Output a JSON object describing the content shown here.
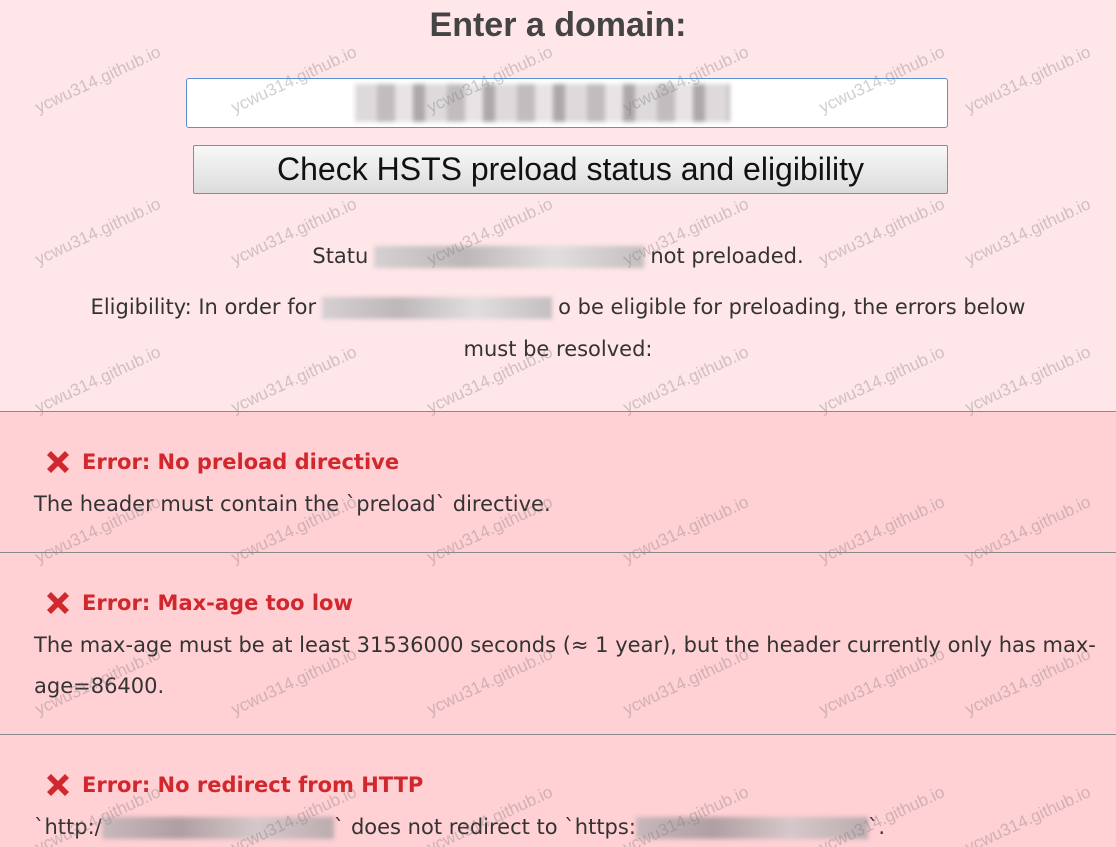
{
  "header": {
    "title": "Enter a domain:"
  },
  "domain_input": {
    "value": ""
  },
  "check_button": {
    "label": "Check HSTS preload status and eligibility"
  },
  "status": {
    "prefix": "Statu",
    "suffix": "not preloaded."
  },
  "eligibility": {
    "prefix": "Eligibility: In order for",
    "suffix": "o be eligible for preloading, the errors below",
    "line2": "must be resolved:"
  },
  "errors": [
    {
      "title": "Error: No preload directive",
      "description": "The header must contain the `preload` directive."
    },
    {
      "title": "Error: Max-age too low",
      "description": "The max-age must be at least 31536000 seconds (≈ 1 year), but the header currently only has max-age=86400."
    },
    {
      "title": "Error: No redirect from HTTP",
      "desc_prefix": "`http:/",
      "desc_mid": "` does not redirect to `https:",
      "desc_suffix": "`."
    }
  ],
  "watermark": {
    "text": "ycwu314.github.io"
  },
  "colors": {
    "background": "#ffe6e8",
    "error_background": "#ffd0d4",
    "error_red": "#d0282d",
    "input_border": "#5b8fd6"
  }
}
